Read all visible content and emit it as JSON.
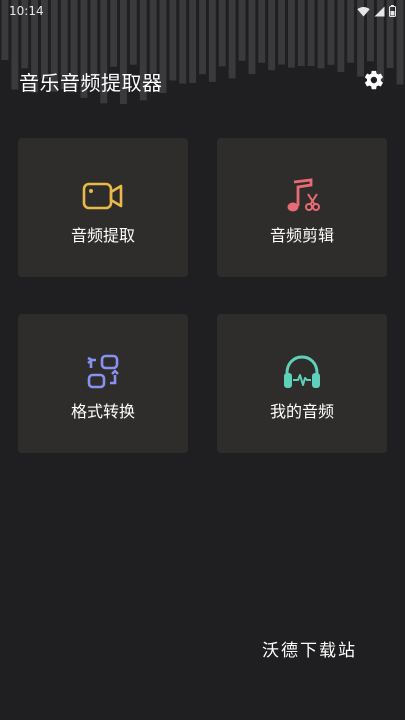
{
  "status_bar": {
    "time": "10:14"
  },
  "header": {
    "title": "音乐音频提取器"
  },
  "cards": [
    {
      "label": "音频提取",
      "icon": "video-camera-icon",
      "color": "#e9b949"
    },
    {
      "label": "音频剪辑",
      "icon": "music-scissors-icon",
      "color": "#e86a74"
    },
    {
      "label": "格式转换",
      "icon": "format-convert-icon",
      "color": "#8890f0"
    },
    {
      "label": "我的音频",
      "icon": "headphones-icon",
      "color": "#5fd0b9"
    }
  ],
  "watermark": "沃德下载站",
  "colors": {
    "background": "#1f1f21",
    "card": "#2e2d2b",
    "wave": "#3a3a3c"
  }
}
